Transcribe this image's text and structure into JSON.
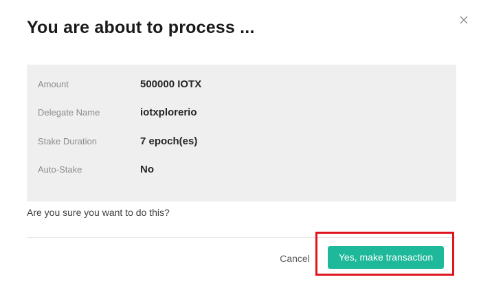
{
  "dialog": {
    "title": "You are about to process ...",
    "close_icon": "close-icon"
  },
  "details": [
    {
      "label": "Amount",
      "value": "500000 IOTX"
    },
    {
      "label": "Delegate Name",
      "value": "iotxplorerio"
    },
    {
      "label": "Stake Duration",
      "value": "7 epoch(es)"
    },
    {
      "label": "Auto-Stake",
      "value": "No"
    }
  ],
  "confirm_prompt": "Are you sure you want to do this?",
  "footer": {
    "cancel_label": "Cancel",
    "confirm_label": "Yes, make transaction"
  },
  "colors": {
    "accent": "#1eb89a",
    "highlight": "#e0141e",
    "panel_bg": "#efefef"
  }
}
